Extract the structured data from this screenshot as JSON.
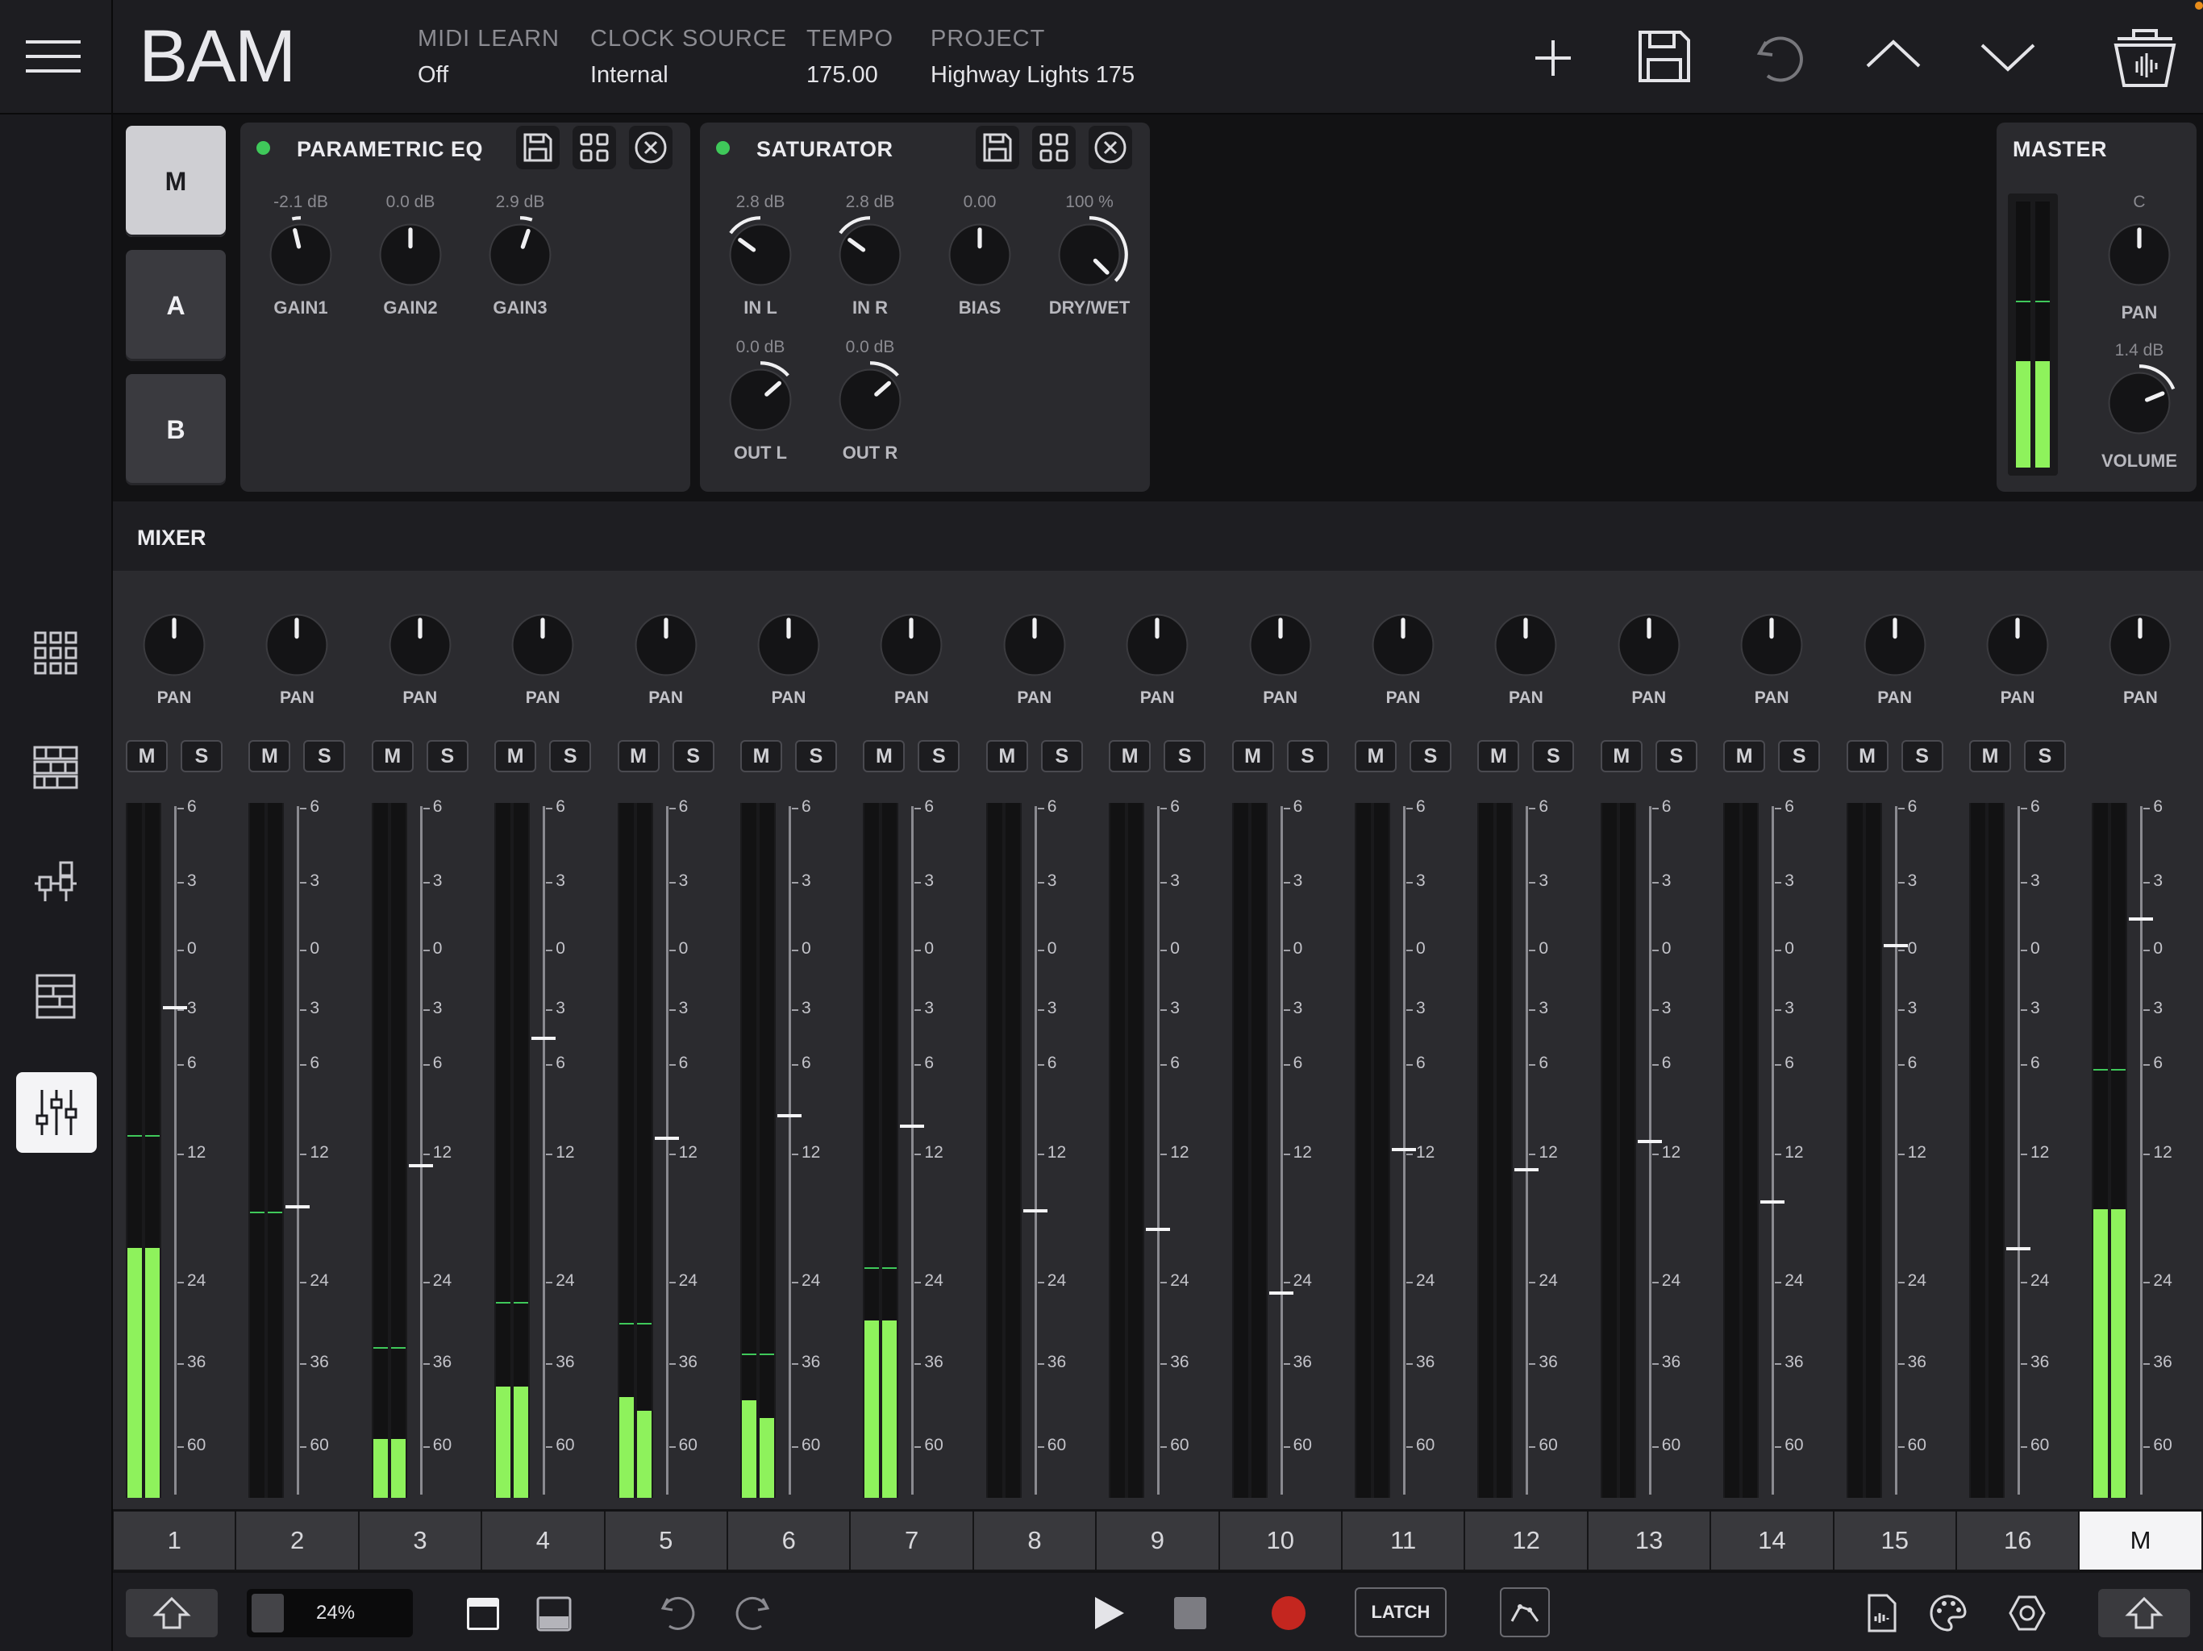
{
  "app": {
    "title": "BAM"
  },
  "header": {
    "midi_learn": {
      "label": "MIDI LEARN",
      "value": "Off"
    },
    "clock_source": {
      "label": "CLOCK SOURCE",
      "value": "Internal"
    },
    "tempo": {
      "label": "TEMPO",
      "value": "175.00"
    },
    "project": {
      "label": "PROJECT",
      "value": "Highway Lights 175"
    },
    "icons": [
      "add-icon",
      "save-icon",
      "undo-icon",
      "chevron-up-icon",
      "chevron-down-icon",
      "trash-icon"
    ]
  },
  "sidebar": {
    "items": [
      "grid-view-icon",
      "sequencer-icon",
      "routing-icon",
      "list-icon",
      "mixer-icon"
    ],
    "active": "mixer-icon"
  },
  "slots": {
    "items": [
      "M",
      "A",
      "B"
    ],
    "selected": "M"
  },
  "effects": [
    {
      "title": "PARAMETRIC EQ",
      "knobs": [
        {
          "label": "GAIN1",
          "value": "-2.1 dB",
          "pos": 0.45
        },
        {
          "label": "GAIN2",
          "value": "0.0 dB",
          "pos": 0.5
        },
        {
          "label": "GAIN3",
          "value": "2.9 dB",
          "pos": 0.57
        }
      ]
    },
    {
      "title": "SATURATOR",
      "knobs": [
        {
          "label": "IN L",
          "value": "2.8 dB",
          "pos": 0.3
        },
        {
          "label": "IN R",
          "value": "2.8 dB",
          "pos": 0.3
        },
        {
          "label": "BIAS",
          "value": "0.00",
          "pos": 0.5
        },
        {
          "label": "DRY/WET",
          "value": "100 %",
          "pos": 1.0
        },
        {
          "label": "OUT L",
          "value": "0.0 dB",
          "pos": 0.68
        },
        {
          "label": "OUT R",
          "value": "0.0 dB",
          "pos": 0.68
        }
      ]
    }
  ],
  "master": {
    "title": "MASTER",
    "pan": {
      "label": "PAN",
      "value": "C",
      "pos": 0.5
    },
    "volume": {
      "label": "VOLUME",
      "value": "1.4 dB",
      "pos": 0.75
    },
    "meter_level": 0.4,
    "meter_peak": 0.62
  },
  "mixer": {
    "title": "MIXER",
    "pan_label": "PAN",
    "mute_label": "M",
    "solo_label": "S",
    "scale": [
      "6",
      "3",
      "0",
      "3",
      "6",
      "12",
      "24",
      "36",
      "60"
    ],
    "channels": [
      {
        "name": "1",
        "pan": 0.5,
        "fader": 0.71,
        "level_l": 0.36,
        "level_r": 0.36,
        "peak": 0.52
      },
      {
        "name": "2",
        "pan": 0.5,
        "fader": 0.42,
        "level_l": 0.0,
        "level_r": 0.0,
        "peak": 0.41
      },
      {
        "name": "3",
        "pan": 0.5,
        "fader": 0.48,
        "level_l": 0.085,
        "level_r": 0.085,
        "peak": 0.215
      },
      {
        "name": "4",
        "pan": 0.5,
        "fader": 0.665,
        "level_l": 0.16,
        "level_r": 0.16,
        "peak": 0.28
      },
      {
        "name": "5",
        "pan": 0.5,
        "fader": 0.52,
        "level_l": 0.145,
        "level_r": 0.125,
        "peak": 0.25
      },
      {
        "name": "6",
        "pan": 0.5,
        "fader": 0.553,
        "level_l": 0.14,
        "level_r": 0.115,
        "peak": 0.205
      },
      {
        "name": "7",
        "pan": 0.5,
        "fader": 0.538,
        "level_l": 0.255,
        "level_r": 0.255,
        "peak": 0.33
      },
      {
        "name": "8",
        "pan": 0.5,
        "fader": 0.415,
        "level_l": 0.0,
        "level_r": 0.0,
        "peak": 0.0
      },
      {
        "name": "9",
        "pan": 0.5,
        "fader": 0.388,
        "level_l": 0.0,
        "level_r": 0.0,
        "peak": 0.0
      },
      {
        "name": "10",
        "pan": 0.5,
        "fader": 0.295,
        "level_l": 0.0,
        "level_r": 0.0,
        "peak": 0.0
      },
      {
        "name": "11",
        "pan": 0.5,
        "fader": 0.503,
        "level_l": 0.0,
        "level_r": 0.0,
        "peak": 0.0
      },
      {
        "name": "12",
        "pan": 0.5,
        "fader": 0.474,
        "level_l": 0.0,
        "level_r": 0.0,
        "peak": 0.0
      },
      {
        "name": "13",
        "pan": 0.5,
        "fader": 0.515,
        "level_l": 0.0,
        "level_r": 0.0,
        "peak": 0.0
      },
      {
        "name": "14",
        "pan": 0.5,
        "fader": 0.427,
        "level_l": 0.0,
        "level_r": 0.0,
        "peak": 0.0
      },
      {
        "name": "15",
        "pan": 0.5,
        "fader": 0.8,
        "level_l": 0.0,
        "level_r": 0.0,
        "peak": 0.0
      },
      {
        "name": "16",
        "pan": 0.5,
        "fader": 0.36,
        "level_l": 0.0,
        "level_r": 0.0,
        "peak": 0.0
      },
      {
        "name": "M",
        "pan": 0.5,
        "fader": 0.838,
        "level_l": 0.415,
        "level_r": 0.415,
        "peak": 0.615,
        "is_master": true
      }
    ],
    "selected": "M"
  },
  "bottombar": {
    "zoom": "24%",
    "latch_label": "LATCH",
    "icons": [
      "shift-up-icon",
      "layout-top-icon",
      "layout-bottom-icon",
      "undo-icon",
      "redo-icon",
      "play-icon",
      "stop-icon",
      "record-icon",
      "automation-icon",
      "export-icon",
      "palette-icon",
      "settings-icon",
      "collapse-up-icon"
    ]
  },
  "colors": {
    "meter": "#8ef25c",
    "led": "#3fc85a",
    "record": "#c4261f",
    "accent": "#f4f4f6"
  }
}
